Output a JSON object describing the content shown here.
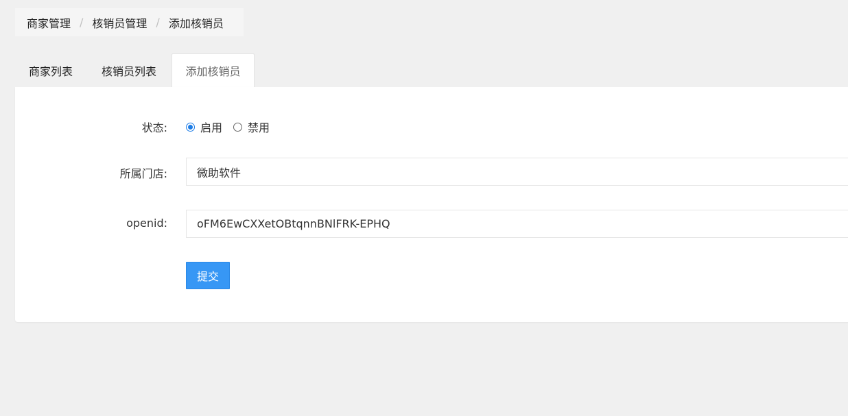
{
  "breadcrumb": {
    "items": [
      "商家管理",
      "核销员管理",
      "添加核销员"
    ],
    "separator": "/"
  },
  "tabs": [
    {
      "label": "商家列表",
      "active": false
    },
    {
      "label": "核销员列表",
      "active": false
    },
    {
      "label": "添加核销员",
      "active": true
    }
  ],
  "form": {
    "status": {
      "label": "状态:",
      "options": [
        {
          "label": "启用",
          "checked": true
        },
        {
          "label": "禁用",
          "checked": false
        }
      ]
    },
    "store": {
      "label": "所属门店:",
      "value": "微助软件"
    },
    "openid": {
      "label": "openid:",
      "value": "oFM6EwCXXetOBtqnnBNlFRK-EPHQ"
    },
    "submit_label": "提交"
  },
  "colors": {
    "primary": "#3797f5",
    "radio_checked": "#1e7de6",
    "background": "#f0f0f0"
  }
}
